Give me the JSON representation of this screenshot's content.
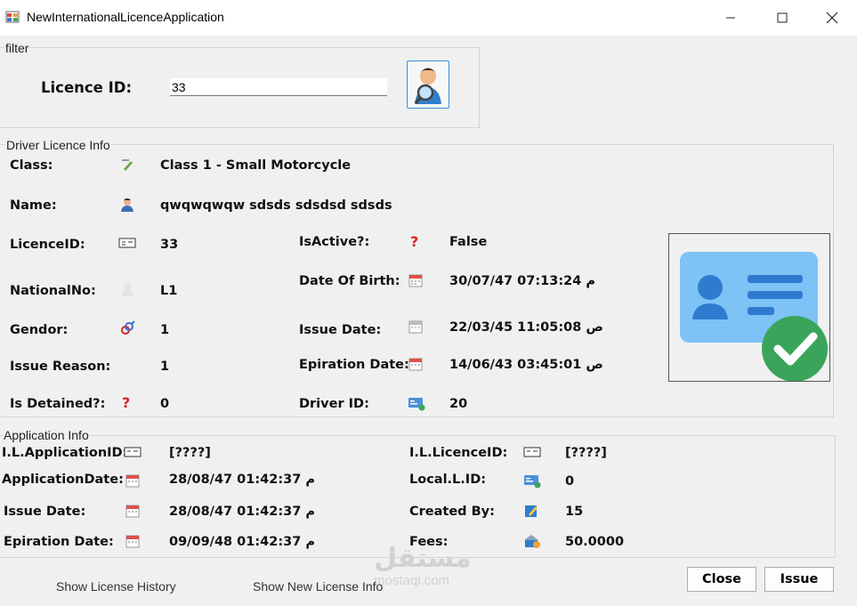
{
  "window": {
    "title": "NewInternationalLicenceApplication"
  },
  "filter": {
    "legend": "filter",
    "licence_id_label": "Licence ID:",
    "licence_id_value": "33"
  },
  "driver_info": {
    "legend": "Driver Licence Info",
    "class_label": "Class:",
    "class_value": "Class 1 - Small Motorcycle",
    "name_label": "Name:",
    "name_value": "qwqwqwqw sdsds sdsdsd sdsds",
    "licence_id_label": "LicenceID:",
    "licence_id_value": "33",
    "national_no_label": "NationalNo:",
    "national_no_value": "L1",
    "gender_label": "Gendor:",
    "gender_value": "1",
    "issue_reason_label": "Issue Reason:",
    "issue_reason_value": "1",
    "is_detained_label": "Is Detained?:",
    "is_detained_value": "0",
    "is_active_label": "IsActive?:",
    "is_active_value": "False",
    "dob_label": "Date Of Birth:",
    "dob_value": "30/07/47 07:13:24 م",
    "issue_date_label": "Issue Date:",
    "issue_date_value": "22/03/45 11:05:08 ص",
    "expiration_label": "Epiration Date:",
    "expiration_value": "14/06/43 03:45:01 ص",
    "driver_id_label": "Driver ID:",
    "driver_id_value": "20"
  },
  "application_info": {
    "legend": "Application Info",
    "il_app_id_label": "I.L.ApplicationID:",
    "il_app_id_value": "[????]",
    "app_date_label": "ApplicationDate:",
    "app_date_value": "28/08/47 01:42:37 م",
    "issue_date_label": "Issue Date:",
    "issue_date_value": "28/08/47 01:42:37 م",
    "expiration_label": "Epiration Date:",
    "expiration_value": "09/09/48 01:42:37 م",
    "il_licence_id_label": "I.L.LicenceID:",
    "il_licence_id_value": "[????]",
    "local_l_id_label": "Local.L.ID:",
    "local_l_id_value": "0",
    "created_by_label": "Created By:",
    "created_by_value": "15",
    "fees_label": "Fees:",
    "fees_value": "50.0000"
  },
  "links": {
    "show_history": "Show  License History",
    "show_new_info": "Show New License Info"
  },
  "buttons": {
    "close": "Close",
    "issue": "Issue"
  },
  "watermark": {
    "arabic": "مستقل",
    "latin": "mostaql.com"
  },
  "icons": {
    "app": "form-icon",
    "search": "person-search-icon",
    "class": "pen-icon",
    "person": "person-icon",
    "card": "id-card-icon",
    "question": "question-mark-icon",
    "calendar": "calendar-icon",
    "gender": "gender-icon",
    "driver": "driver-card-icon",
    "photo": "licence-card-check-icon",
    "edit": "edit-icon",
    "fees": "money-icon"
  },
  "colors": {
    "accent_blue": "#3a8fd8",
    "check_green": "#3aa55a",
    "red": "#d32626"
  }
}
